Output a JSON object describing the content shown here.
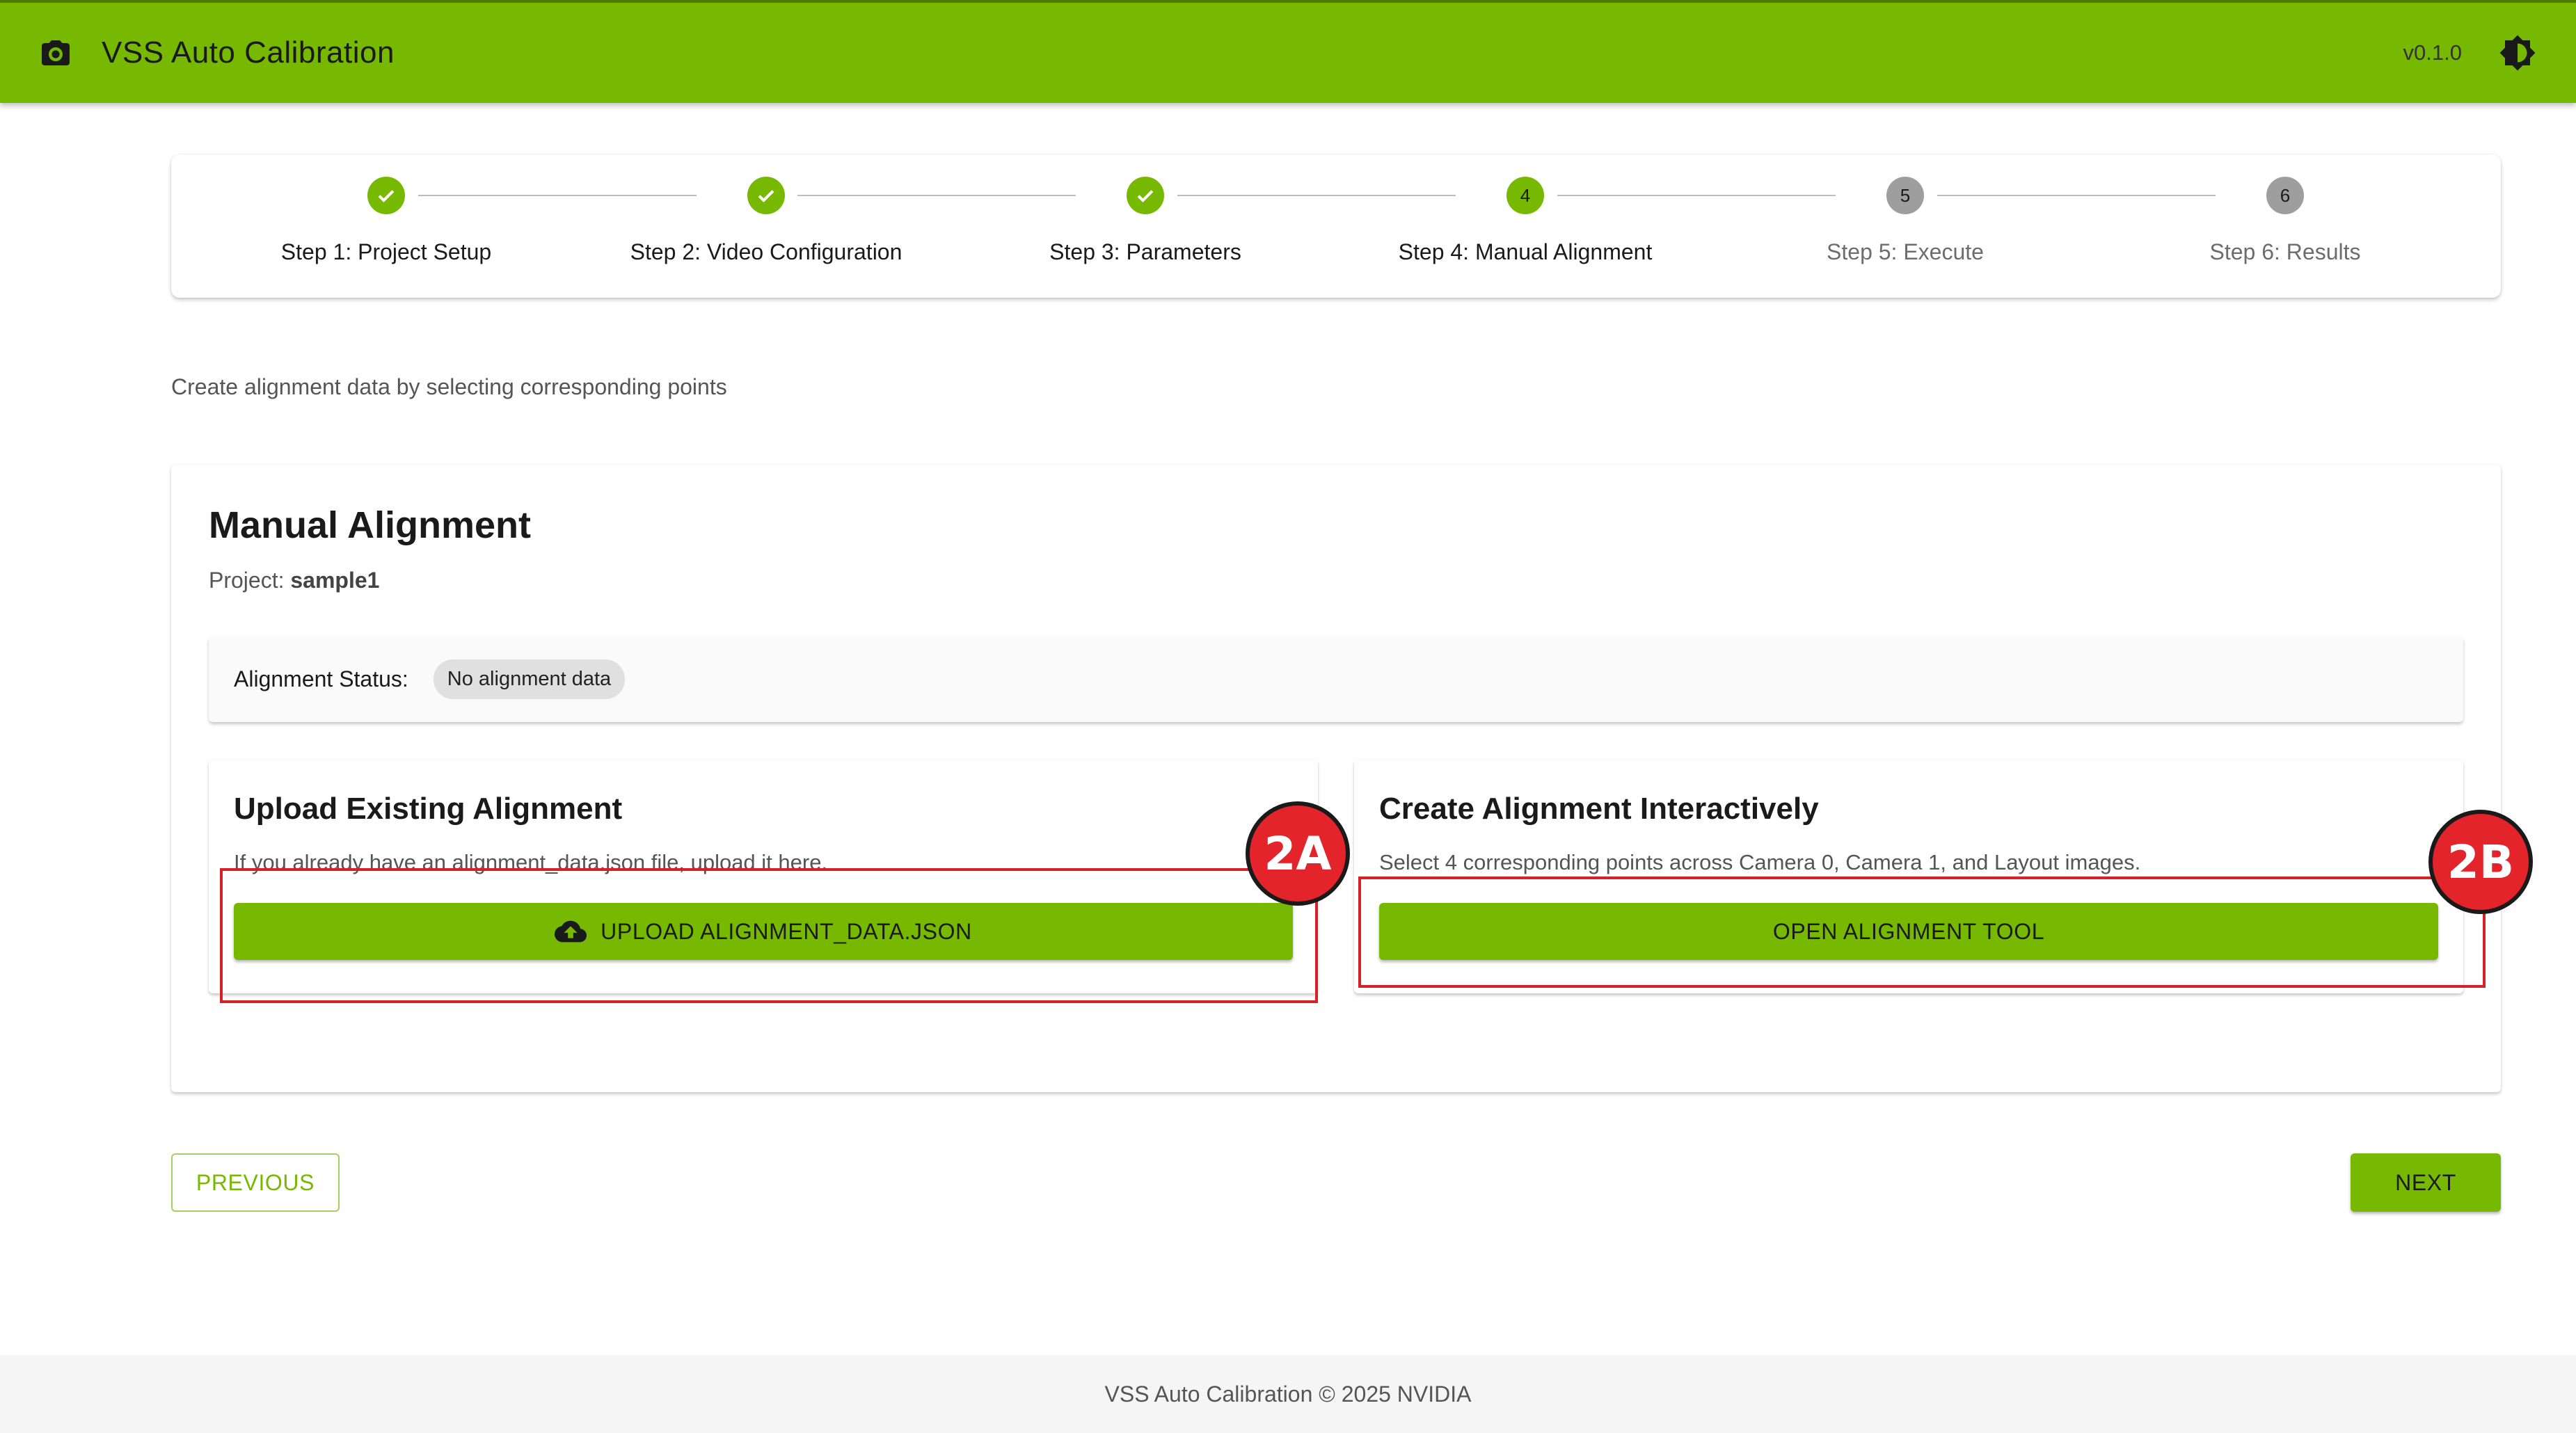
{
  "app": {
    "title": "VSS Auto Calibration",
    "version": "v0.1.0",
    "icons": {
      "logo": "camera-icon",
      "theme": "brightness-icon"
    },
    "colors": {
      "primary": "#76b900",
      "pending": "#9e9e9e",
      "annotation": "#e3242b"
    }
  },
  "stepper": {
    "steps": [
      {
        "label": "Step 1: Project Setup",
        "state": "completed",
        "number": "1"
      },
      {
        "label": "Step 2: Video Configuration",
        "state": "completed",
        "number": "2"
      },
      {
        "label": "Step 3: Parameters",
        "state": "completed",
        "number": "3"
      },
      {
        "label": "Step 4: Manual Alignment",
        "state": "active",
        "number": "4"
      },
      {
        "label": "Step 5: Execute",
        "state": "pending",
        "number": "5"
      },
      {
        "label": "Step 6: Results",
        "state": "pending",
        "number": "6"
      }
    ]
  },
  "intro": "Create alignment data by selecting corresponding points",
  "manual_alignment": {
    "heading": "Manual Alignment",
    "project_label": "Project:",
    "project_name": "sample1",
    "status_label": "Alignment Status:",
    "status_value": "No alignment data",
    "upload": {
      "title": "Upload Existing Alignment",
      "description": "If you already have an alignment_data.json file, upload it here.",
      "button": "UPLOAD ALIGNMENT_DATA.JSON"
    },
    "interactive": {
      "title": "Create Alignment Interactively",
      "description": "Select 4 corresponding points across Camera 0, Camera 1, and Layout images.",
      "button": "OPEN ALIGNMENT TOOL"
    }
  },
  "annotations": {
    "a": "2A",
    "b": "2B"
  },
  "nav": {
    "previous": "PREVIOUS",
    "next": "NEXT"
  },
  "footer": "VSS Auto Calibration © 2025 NVIDIA"
}
